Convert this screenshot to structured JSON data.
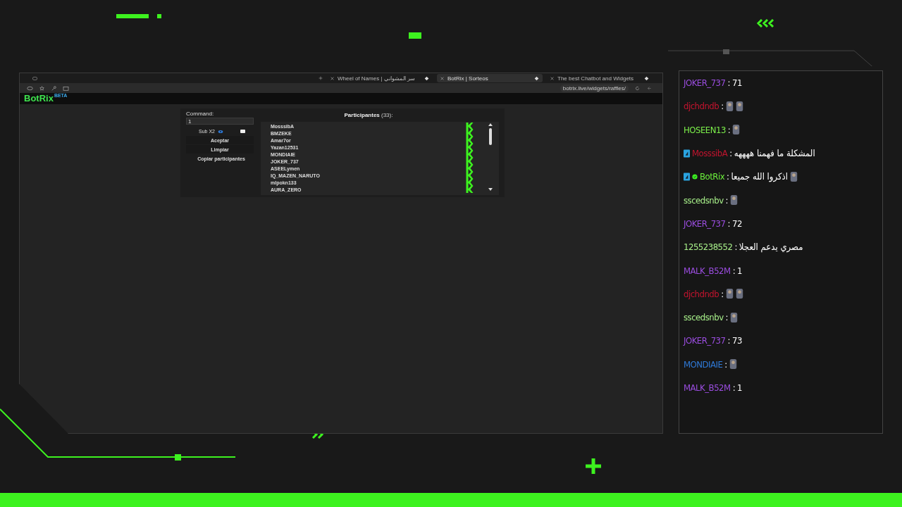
{
  "browser": {
    "tabs": [
      {
        "title": "Wheel of Names | سر المشواني",
        "selected": false
      },
      {
        "title": "BotRix | Sorteos",
        "selected": true
      },
      {
        "title": "The best Chatbot and Widgets",
        "selected": false
      }
    ],
    "url": "botrix.live/widgets/raffles/"
  },
  "app": {
    "logo": "BotRix",
    "logo_badge": "BETA",
    "command": {
      "label": "Command:",
      "value": "1"
    },
    "sub_option": {
      "label": "Sub X2",
      "checked": false
    },
    "buttons": [
      "Aceptar",
      "Limpiar",
      "Copiar participantes"
    ],
    "participants_title": "Participantes",
    "participants_count": "(33):",
    "participants": [
      "MosssibA",
      "BMZEKE",
      "Amar7or",
      "Yazan12531",
      "MONDIAIE",
      "JOKER_737",
      "ASEELymen",
      "IQ_MAZEN_NARUTO",
      "mlpokn133",
      "AURA_ZERO"
    ]
  },
  "chat_separator": ":",
  "chat": [
    {
      "user": "JOKER_737",
      "color": "#9b4de0",
      "parts": [
        {
          "kind": "text",
          "text": "71"
        }
      ]
    },
    {
      "user": "djchdndb",
      "color": "#c3142e",
      "parts": [
        {
          "kind": "emote"
        },
        {
          "kind": "emote"
        }
      ]
    },
    {
      "user": "HOSEEN13",
      "color": "#7cf04a",
      "parts": [
        {
          "kind": "emote"
        }
      ]
    },
    {
      "user": "MosssibA",
      "color": "#c3142e",
      "badges": [
        {
          "kind": "sub"
        }
      ],
      "parts": [
        {
          "kind": "text",
          "text": "المشكلة ما فهمنا ههههه"
        }
      ]
    },
    {
      "user": "BotRix",
      "color": "#6cf03c",
      "badges": [
        {
          "kind": "sub"
        },
        {
          "kind": "verified"
        }
      ],
      "parts": [
        {
          "kind": "text",
          "text": "اذكروا الله جميعا"
        },
        {
          "kind": "emote"
        }
      ]
    },
    {
      "user": "sscedsnbv",
      "color": "#a8f08a",
      "parts": [
        {
          "kind": "emote"
        }
      ]
    },
    {
      "user": "JOKER_737",
      "color": "#9b4de0",
      "parts": [
        {
          "kind": "text",
          "text": "72"
        }
      ]
    },
    {
      "user": "1255238552",
      "color": "#a8f08a",
      "parts": [
        {
          "kind": "text",
          "text": "مصري يدعم العجلا"
        }
      ]
    },
    {
      "user": "MALK_B52M",
      "color": "#9b4de0",
      "parts": [
        {
          "kind": "text",
          "text": "1"
        }
      ]
    },
    {
      "user": "djchdndb",
      "color": "#c3142e",
      "parts": [
        {
          "kind": "emote"
        },
        {
          "kind": "emote"
        }
      ]
    },
    {
      "user": "sscedsnbv",
      "color": "#a8f08a",
      "parts": [
        {
          "kind": "emote"
        }
      ]
    },
    {
      "user": "JOKER_737",
      "color": "#9b4de0",
      "parts": [
        {
          "kind": "text",
          "text": "73"
        }
      ]
    },
    {
      "user": "MONDIAIE",
      "color": "#2f7ad8",
      "parts": [
        {
          "kind": "emote"
        }
      ]
    },
    {
      "user": "MALK_B52M",
      "color": "#9b4de0",
      "parts": [
        {
          "kind": "text",
          "text": "1"
        }
      ]
    }
  ]
}
